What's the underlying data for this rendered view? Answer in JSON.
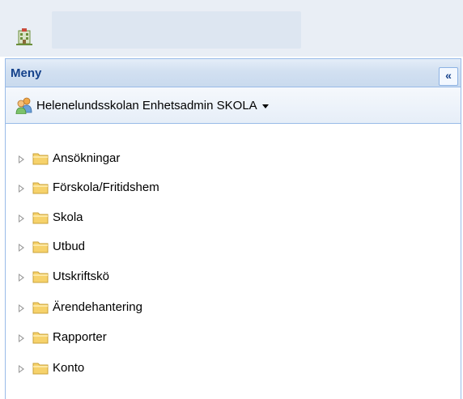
{
  "header": {
    "app_icon": "building-icon",
    "title": ""
  },
  "panel": {
    "title": "Meny",
    "collapse_label": "«",
    "user": {
      "icon": "users-icon",
      "label": "Helenelundsskolan Enhetsadmin SKOLA",
      "dropdown_icon": "caret-down-icon"
    }
  },
  "tree": {
    "items": [
      {
        "label": "Ansökningar",
        "icon": "folder-icon"
      },
      {
        "label": "Förskola/Fritidshem",
        "icon": "folder-icon"
      },
      {
        "label": "Skola",
        "icon": "folder-icon"
      },
      {
        "label": "Utbud",
        "icon": "folder-icon"
      },
      {
        "label": "Utskriftskö",
        "icon": "folder-icon"
      },
      {
        "label": "Ärendehantering",
        "icon": "folder-icon"
      },
      {
        "label": "Rapporter",
        "icon": "folder-icon"
      },
      {
        "label": "Konto",
        "icon": "folder-icon"
      }
    ]
  },
  "colors": {
    "accent": "#15428b",
    "border": "#99bbe8",
    "folder": "#f6d26b"
  }
}
